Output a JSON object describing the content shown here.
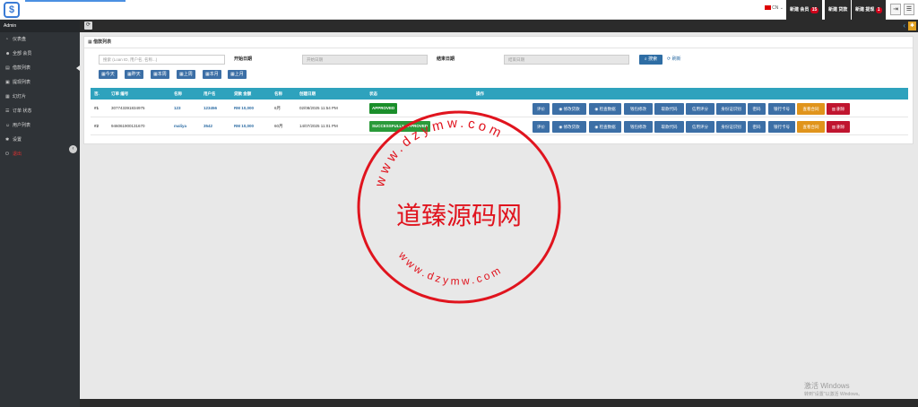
{
  "top": {
    "lang": "CN",
    "buttons": [
      {
        "label": "新建 会员",
        "badge": "15"
      },
      {
        "label": "新建 贷款",
        "badge": ""
      },
      {
        "label": "新建 提现",
        "badge": "1"
      }
    ]
  },
  "sidebar": {
    "header": "Admin",
    "items": [
      {
        "label": "仪表盘"
      },
      {
        "label": "全部 会员"
      },
      {
        "label": "借款列表"
      },
      {
        "label": "提现列表"
      },
      {
        "label": "幻灯片"
      },
      {
        "label": "订单 状态"
      },
      {
        "label": "用户列表"
      },
      {
        "label": "设置"
      },
      {
        "label": "退出"
      }
    ]
  },
  "panel": {
    "title": "借款列表",
    "search_placeholder": "搜索 (Loan ID, 用户名, 名称...)",
    "start_label": "开始日期",
    "start_placeholder": "开始日期",
    "end_label": "结束日期",
    "end_placeholder": "结束日期",
    "search_btn": "搜索",
    "reset": "刷新",
    "quick": [
      "今天",
      "昨天",
      "本周",
      "上周",
      "本月",
      "上月"
    ]
  },
  "table": {
    "headers": [
      "否.",
      "订单 编号",
      "名称",
      "用户名",
      "贷款 金额",
      "名称",
      "创建日期",
      "状态",
      "操作"
    ],
    "rows": [
      {
        "no": "#1",
        "order": "307743391834975",
        "name": "123",
        "user": "123456",
        "amount": "RM 10,000",
        "term": "6月",
        "date": "02/08/2025 11:54 PM",
        "status": "APPROVED"
      },
      {
        "no": "#2",
        "order": "946061900131670",
        "name": "maliya",
        "user": "3542",
        "amount": "RM 10,000",
        "term": "60月",
        "date": "14/07/2025 11:01 PM",
        "status": "SUCCESSFULLY APPROVED"
      }
    ],
    "actions": [
      "评价",
      "修改贷款",
      "检查数据",
      "钱包修改",
      "取款代码",
      "信用评分",
      "身份证识别",
      "密码",
      "银行卡号",
      "查看合同",
      "删除"
    ]
  },
  "watermark": {
    "center": "道臻源码网",
    "ring_top": "www.dzymw.com",
    "ring_bottom": "www.dzymw.com"
  },
  "windows": {
    "line1": "激活 Windows",
    "line2": "转到\"设置\"以激活 Windows。"
  }
}
